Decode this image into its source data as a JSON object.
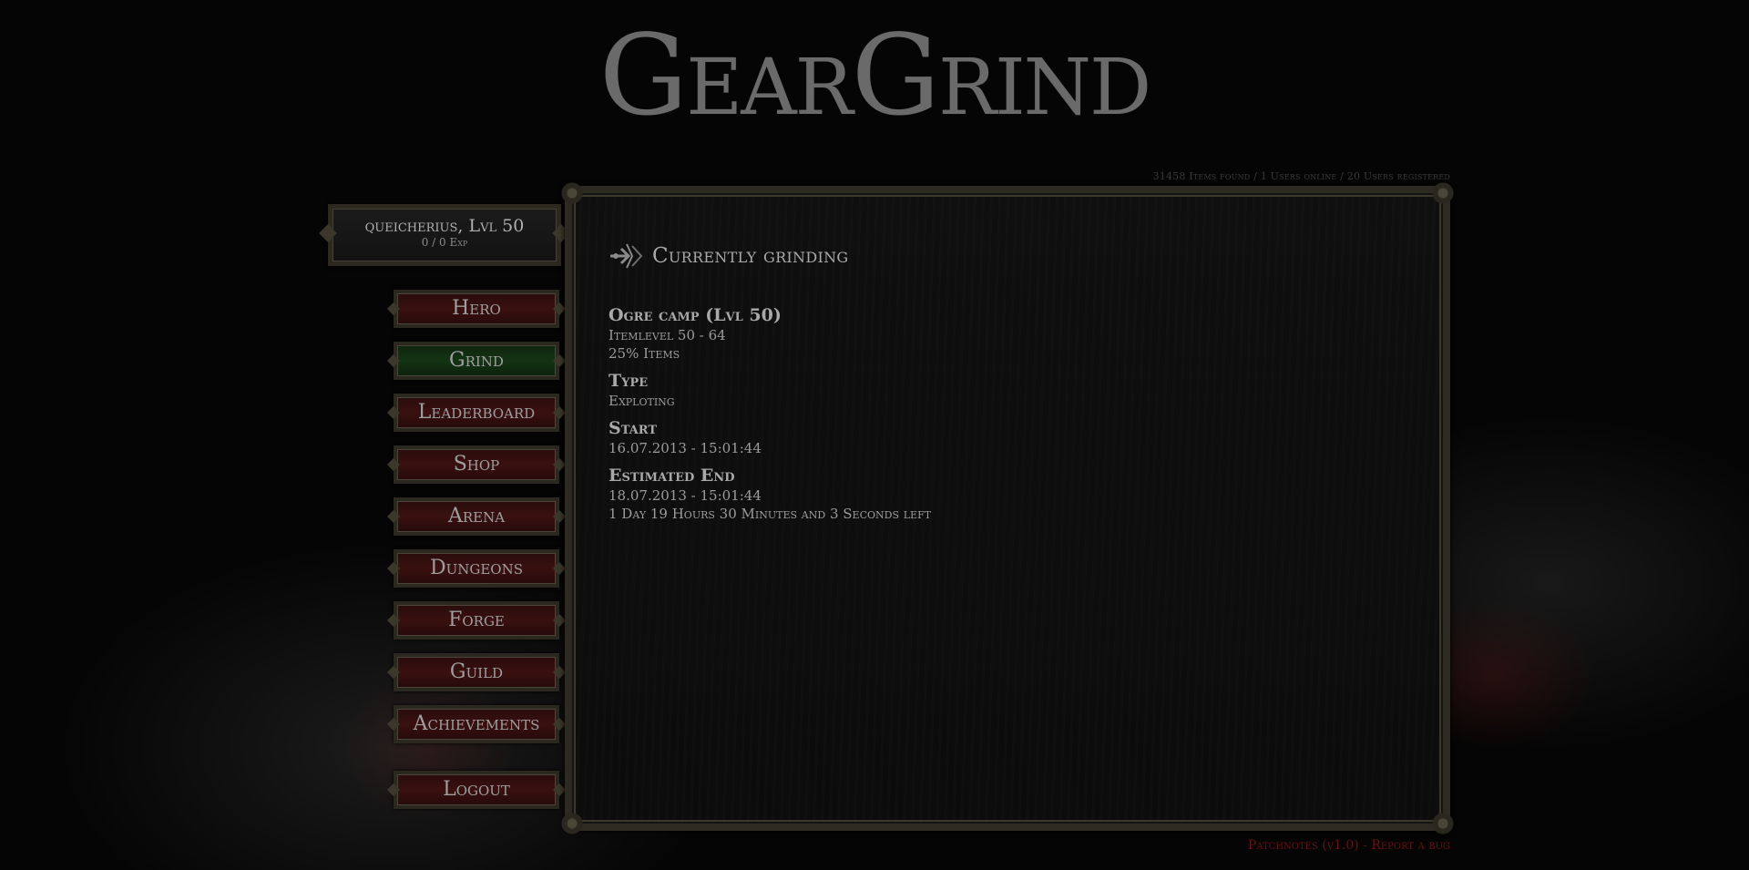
{
  "logo": {
    "text": "GearGrind"
  },
  "stats": {
    "text": "31458 Items found / 1 Users online / 20 Users registered"
  },
  "player": {
    "name_level": "queicherius, Lvl 50",
    "exp": "0 / 0 Exp"
  },
  "nav": {
    "items": [
      {
        "label": "Hero"
      },
      {
        "label": "Grind"
      },
      {
        "label": "Leaderboard"
      },
      {
        "label": "Shop"
      },
      {
        "label": "Arena"
      },
      {
        "label": "Dungeons"
      },
      {
        "label": "Forge"
      },
      {
        "label": "Guild"
      },
      {
        "label": "Achievements"
      }
    ],
    "active": "Grind",
    "logout": "Logout"
  },
  "panel": {
    "heading": "Currently grinding",
    "heading_icon": "grind-icon",
    "location_title": "Ogre camp (Lvl 50)",
    "itemlevel": "Itemlevel 50 - 64",
    "items": "25% Items",
    "type_title": "Type",
    "type_value": "Exploting",
    "start_title": "Start",
    "start_value": "16.07.2013 - 15:01:44",
    "end_title": "Estimated End",
    "end_value": "18.07.2013 - 15:01:44",
    "time_left": "1 Day 19 Hours 30 Minutes and 3 Seconds left"
  },
  "footer": {
    "patchnotes": "Patchnotes (v1.0)",
    "separator": " - ",
    "report": "Report a bug"
  },
  "colors": {
    "button_red": "#3a1010",
    "button_green": "#143414",
    "frame": "#2d2a21",
    "footer_link": "#6a1010"
  }
}
